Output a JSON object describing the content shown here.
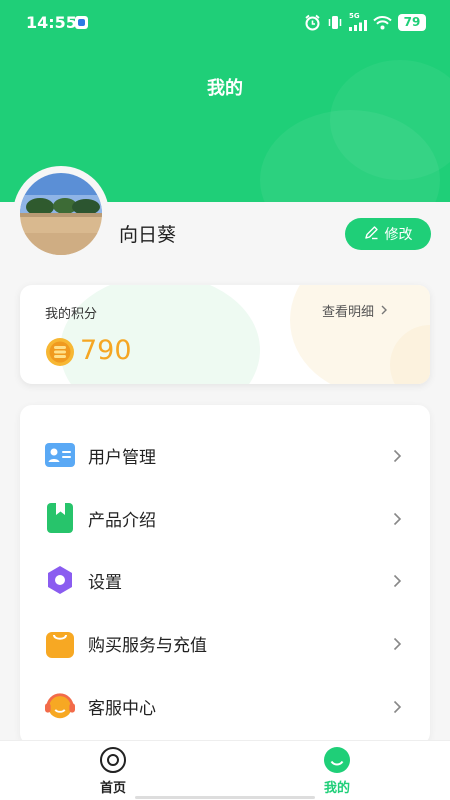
{
  "status_bar": {
    "time": "14:55",
    "network": "5G",
    "battery": "79",
    "icons": [
      "app-notification-icon",
      "alarm-icon",
      "vibrate-icon",
      "signal-icon",
      "wifi-icon",
      "battery-icon"
    ]
  },
  "header": {
    "title": "我的"
  },
  "profile": {
    "username": "向日葵",
    "edit_label": "修改",
    "edit_icon": "pencil-icon"
  },
  "points": {
    "label": "我的积分",
    "detail_label": "查看明细",
    "value": "790",
    "coin_icon": "coin-icon"
  },
  "menu": {
    "items": [
      {
        "label": "用户管理",
        "icon": "user-card-icon"
      },
      {
        "label": "产品介绍",
        "icon": "bookmark-book-icon"
      },
      {
        "label": "设置",
        "icon": "hexagon-settings-icon"
      },
      {
        "label": "购买服务与充值",
        "icon": "shopping-bag-icon"
      },
      {
        "label": "客服中心",
        "icon": "customer-service-icon"
      }
    ]
  },
  "tabbar": {
    "tabs": [
      {
        "label": "首页",
        "icon": "home-target-icon",
        "active": false
      },
      {
        "label": "我的",
        "icon": "smile-face-icon",
        "active": true
      }
    ]
  },
  "colors": {
    "brand_green": "#1fcf78",
    "points_orange": "#f5a623",
    "background": "#f6f6f6"
  }
}
